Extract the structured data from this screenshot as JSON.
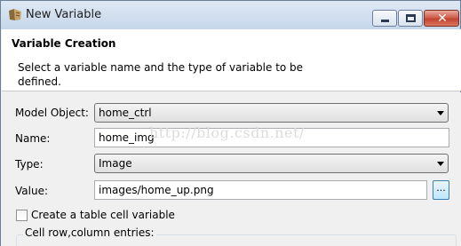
{
  "window": {
    "title": "New Variable",
    "min_glyph": "",
    "close_glyph": "✕"
  },
  "header": {
    "title": "Variable Creation",
    "description": "Select a variable name and the type of variable to be defined."
  },
  "form": {
    "model_object": {
      "label": "Model Object:",
      "value": "home_ctrl"
    },
    "name": {
      "label": "Name:",
      "value": "home_img"
    },
    "type": {
      "label": "Type:",
      "value": "Image"
    },
    "value": {
      "label": "Value:",
      "value": "images/home_up.png",
      "browse_label": "..."
    },
    "table_cell": {
      "label": "Create a table cell variable",
      "checked": false
    },
    "cell_group_label": "Cell row,column entries:"
  },
  "watermark": "http://blog.csdn.net/",
  "colors": {
    "close": "#c4432f",
    "titlebar": "#d3e0ef"
  }
}
